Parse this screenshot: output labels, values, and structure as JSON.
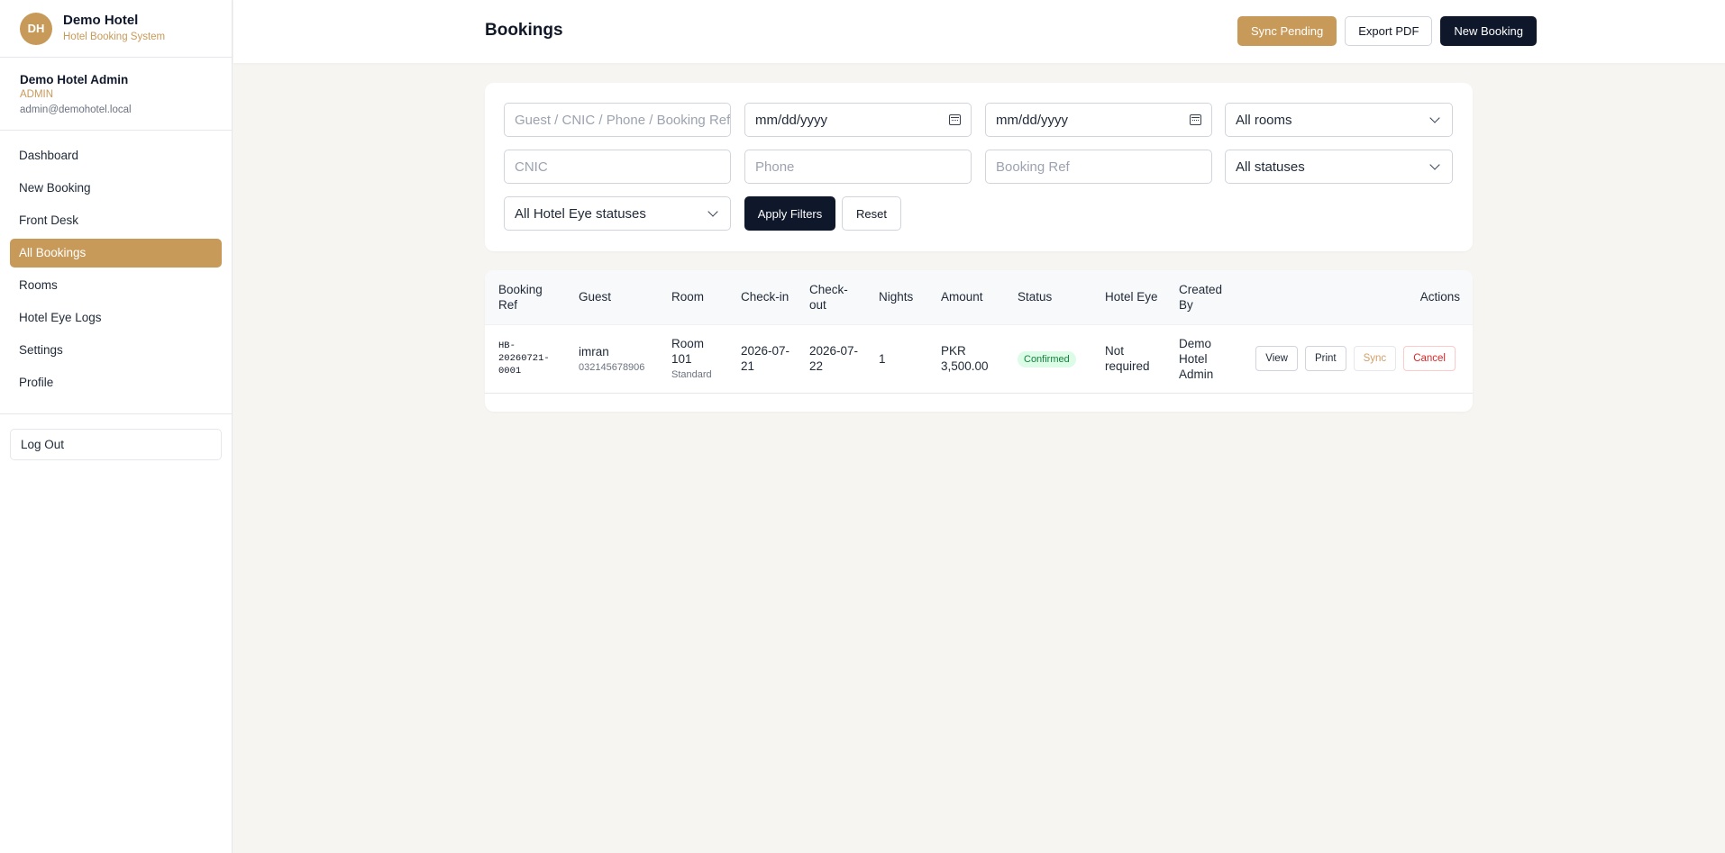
{
  "brand": {
    "initials": "DH",
    "name": "Demo Hotel",
    "subtitle": "Hotel Booking System"
  },
  "user": {
    "name": "Demo Hotel Admin",
    "role": "ADMIN",
    "email": "admin@demohotel.local"
  },
  "nav": [
    {
      "label": "Dashboard",
      "active": false
    },
    {
      "label": "New Booking",
      "active": false
    },
    {
      "label": "Front Desk",
      "active": false
    },
    {
      "label": "All Bookings",
      "active": true
    },
    {
      "label": "Rooms",
      "active": false
    },
    {
      "label": "Hotel Eye Logs",
      "active": false
    },
    {
      "label": "Settings",
      "active": false
    },
    {
      "label": "Profile",
      "active": false
    }
  ],
  "logout_label": "Log Out",
  "header": {
    "title": "Bookings",
    "sync_pending": "Sync Pending",
    "export_pdf": "Export PDF",
    "new_booking": "New Booking"
  },
  "filters": {
    "search_placeholder": "Guest / CNIC / Phone / Booking Ref",
    "date_from": "mm/dd/yyyy",
    "date_to": "mm/dd/yyyy",
    "rooms_select": "All rooms",
    "cnic_placeholder": "CNIC",
    "phone_placeholder": "Phone",
    "booking_ref_placeholder": "Booking Ref",
    "status_select": "All statuses",
    "hotel_eye_select": "All Hotel Eye statuses",
    "apply": "Apply Filters",
    "reset": "Reset"
  },
  "table": {
    "headers": {
      "booking_ref": "Booking Ref",
      "guest": "Guest",
      "room": "Room",
      "check_in": "Check-in",
      "check_out": "Check-out",
      "nights": "Nights",
      "amount": "Amount",
      "status": "Status",
      "hotel_eye": "Hotel Eye",
      "created_by": "Created By",
      "actions": "Actions"
    },
    "rows": [
      {
        "booking_ref": "HB-20260721-0001",
        "guest_name": "imran",
        "guest_phone": "032145678906",
        "room": "Room 101",
        "room_type": "Standard",
        "check_in": "2026-07-21",
        "check_out": "2026-07-22",
        "nights": "1",
        "amount": "PKR 3,500.00",
        "status": "Confirmed",
        "hotel_eye": "Not required",
        "created_by": "Demo Hotel Admin",
        "actions": {
          "view": "View",
          "print": "Print",
          "sync": "Sync",
          "cancel": "Cancel"
        }
      }
    ]
  },
  "colors": {
    "accent": "#c79a5a",
    "dark": "#0f172a",
    "page_bg": "#f7f5f1",
    "status_confirmed_bg": "#dcfce7",
    "status_confirmed_text": "#15803d",
    "danger": "#dc2626"
  }
}
